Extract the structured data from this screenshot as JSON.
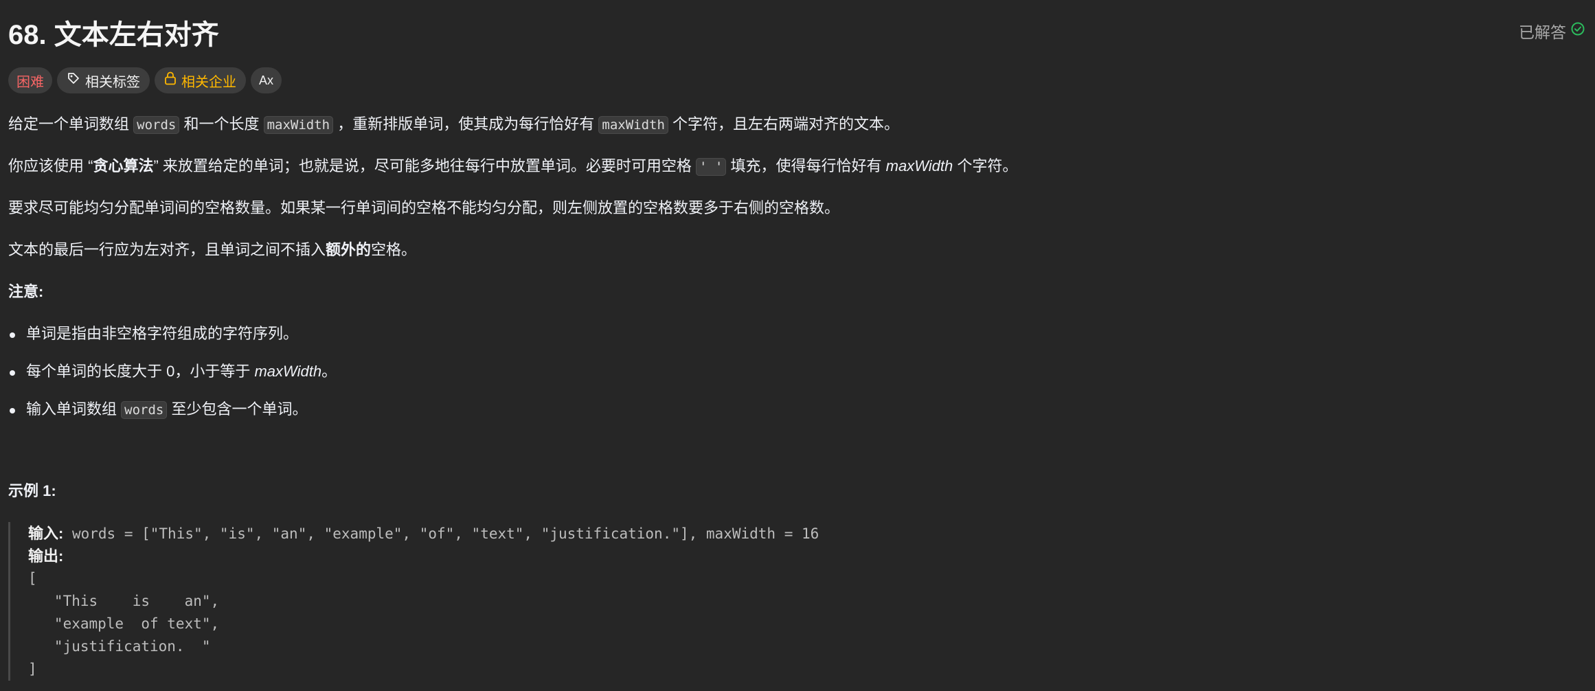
{
  "problem": {
    "title": "68. 文本左右对齐",
    "status": "已解答",
    "status_color": "#2cbb5d"
  },
  "tags": {
    "difficulty": "困难",
    "difficulty_color": "#f56565",
    "related_tags": "相关标签",
    "related_companies": "相关企业",
    "translate": "Ax"
  },
  "description": {
    "p1": {
      "a": "给定一个单词数组",
      "code1": "words",
      "b": "和一个长度",
      "code2": "maxWidth",
      "c": "，重新排版单词，使其成为每行恰好有",
      "code3": "maxWidth",
      "d": "个字符，且左右两端对齐的文本。"
    },
    "p2": {
      "a": "你应该使用 “",
      "bold": "贪心算法",
      "b": "” 来放置给定的单词；也就是说，尽可能多地往每行中放置单词。必要时可用空格",
      "code": "' '",
      "c": "填充，使得每行恰好有",
      "em": "maxWidth",
      "d": "个字符。"
    },
    "p3": "要求尽可能均匀分配单词间的空格数量。如果某一行单词间的空格不能均匀分配，则左侧放置的空格数要多于右侧的空格数。",
    "p4": {
      "a": "文本的最后一行应为左对齐，且单词之间不插入",
      "bold": "额外的",
      "b": "空格。"
    },
    "note_label": "注意:",
    "notes": {
      "n1": "单词是指由非空格字符组成的字符序列。",
      "n2_a": "每个单词的长度大于 0，小于等于",
      "n2_em": "maxWidth",
      "n2_b": "。",
      "n3_a": "输入单词数组",
      "n3_code": "words",
      "n3_b": "至少包含一个单词。"
    }
  },
  "example1": {
    "title": "示例 1:",
    "input_label": "输入:",
    "input_value": " words = [\"This\", \"is\", \"an\", \"example\", \"of\", \"text\", \"justification.\"], maxWidth = 16",
    "output_label": "输出:",
    "output_lines": [
      "[",
      "   \"This    is    an\",",
      "   \"example  of text\",",
      "   \"justification.  \"",
      "]"
    ]
  }
}
